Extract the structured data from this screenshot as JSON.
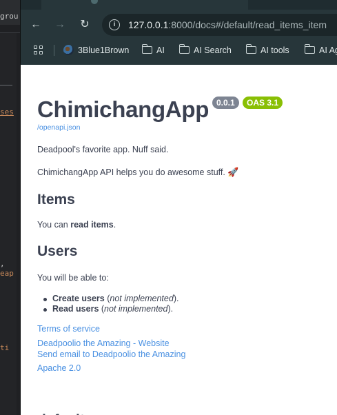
{
  "editor": {
    "tab_fragment": "grou",
    "code_lines": [
      "ses",
      ",",
      "eap",
      "ti"
    ]
  },
  "browser": {
    "nav": {
      "back": "←",
      "forward": "→",
      "reload": "↻"
    },
    "url_host": "127.0.0.1",
    "url_rest": ":8000/docs#/default/read_items_item",
    "bookmarks": [
      "3Blue1Brown",
      "AI",
      "AI Search",
      "AI tools",
      "AI Ag"
    ]
  },
  "doc": {
    "title": "ChimichangApp",
    "version_badge": "0.0.1",
    "oas_badge": "OAS 3.1",
    "spec_link": "/openapi.json",
    "summary": "Deadpool's favorite app. Nuff said.",
    "description": "ChimichangApp API helps you do awesome stuff.",
    "description_emoji": "🚀",
    "items_heading": "Items",
    "items_text_pre": "You can ",
    "items_text_bold": "read items",
    "items_text_post": ".",
    "users_heading": "Users",
    "users_intro": "You will be able to:",
    "users_bullets": [
      {
        "bold": "Create users",
        "pre": " (",
        "italic": "not implemented",
        "post": ")."
      },
      {
        "bold": "Read users",
        "pre": " (",
        "italic": "not implemented",
        "post": ")."
      }
    ],
    "terms_link": "Terms of service",
    "website_link": "Deadpoolio the Amazing - Website",
    "email_link": "Send email to Deadpoolio the Amazing",
    "license_link": "Apache 2.0",
    "next_heading": "default"
  }
}
